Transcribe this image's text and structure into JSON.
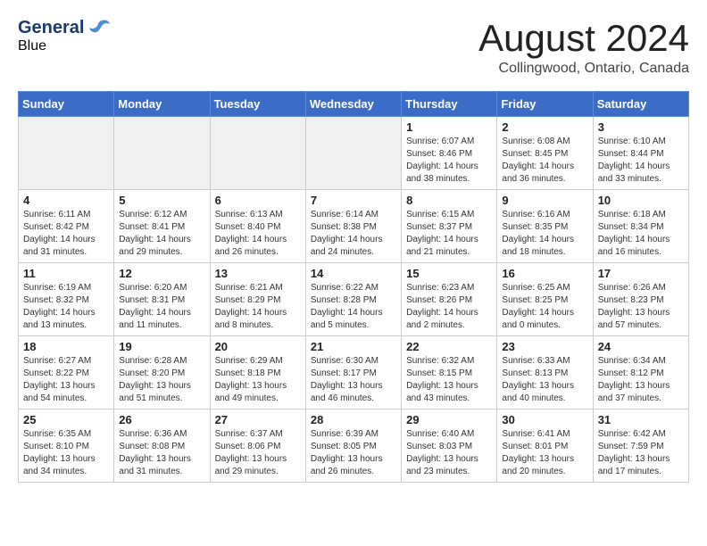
{
  "logo": {
    "general": "General",
    "blue": "Blue"
  },
  "title": "August 2024",
  "location": "Collingwood, Ontario, Canada",
  "days_of_week": [
    "Sunday",
    "Monday",
    "Tuesday",
    "Wednesday",
    "Thursday",
    "Friday",
    "Saturday"
  ],
  "weeks": [
    [
      {
        "day": "",
        "info": ""
      },
      {
        "day": "",
        "info": ""
      },
      {
        "day": "",
        "info": ""
      },
      {
        "day": "",
        "info": ""
      },
      {
        "day": "1",
        "info": "Sunrise: 6:07 AM\nSunset: 8:46 PM\nDaylight: 14 hours and 38 minutes."
      },
      {
        "day": "2",
        "info": "Sunrise: 6:08 AM\nSunset: 8:45 PM\nDaylight: 14 hours and 36 minutes."
      },
      {
        "day": "3",
        "info": "Sunrise: 6:10 AM\nSunset: 8:44 PM\nDaylight: 14 hours and 33 minutes."
      }
    ],
    [
      {
        "day": "4",
        "info": "Sunrise: 6:11 AM\nSunset: 8:42 PM\nDaylight: 14 hours and 31 minutes."
      },
      {
        "day": "5",
        "info": "Sunrise: 6:12 AM\nSunset: 8:41 PM\nDaylight: 14 hours and 29 minutes."
      },
      {
        "day": "6",
        "info": "Sunrise: 6:13 AM\nSunset: 8:40 PM\nDaylight: 14 hours and 26 minutes."
      },
      {
        "day": "7",
        "info": "Sunrise: 6:14 AM\nSunset: 8:38 PM\nDaylight: 14 hours and 24 minutes."
      },
      {
        "day": "8",
        "info": "Sunrise: 6:15 AM\nSunset: 8:37 PM\nDaylight: 14 hours and 21 minutes."
      },
      {
        "day": "9",
        "info": "Sunrise: 6:16 AM\nSunset: 8:35 PM\nDaylight: 14 hours and 18 minutes."
      },
      {
        "day": "10",
        "info": "Sunrise: 6:18 AM\nSunset: 8:34 PM\nDaylight: 14 hours and 16 minutes."
      }
    ],
    [
      {
        "day": "11",
        "info": "Sunrise: 6:19 AM\nSunset: 8:32 PM\nDaylight: 14 hours and 13 minutes."
      },
      {
        "day": "12",
        "info": "Sunrise: 6:20 AM\nSunset: 8:31 PM\nDaylight: 14 hours and 11 minutes."
      },
      {
        "day": "13",
        "info": "Sunrise: 6:21 AM\nSunset: 8:29 PM\nDaylight: 14 hours and 8 minutes."
      },
      {
        "day": "14",
        "info": "Sunrise: 6:22 AM\nSunset: 8:28 PM\nDaylight: 14 hours and 5 minutes."
      },
      {
        "day": "15",
        "info": "Sunrise: 6:23 AM\nSunset: 8:26 PM\nDaylight: 14 hours and 2 minutes."
      },
      {
        "day": "16",
        "info": "Sunrise: 6:25 AM\nSunset: 8:25 PM\nDaylight: 14 hours and 0 minutes."
      },
      {
        "day": "17",
        "info": "Sunrise: 6:26 AM\nSunset: 8:23 PM\nDaylight: 13 hours and 57 minutes."
      }
    ],
    [
      {
        "day": "18",
        "info": "Sunrise: 6:27 AM\nSunset: 8:22 PM\nDaylight: 13 hours and 54 minutes."
      },
      {
        "day": "19",
        "info": "Sunrise: 6:28 AM\nSunset: 8:20 PM\nDaylight: 13 hours and 51 minutes."
      },
      {
        "day": "20",
        "info": "Sunrise: 6:29 AM\nSunset: 8:18 PM\nDaylight: 13 hours and 49 minutes."
      },
      {
        "day": "21",
        "info": "Sunrise: 6:30 AM\nSunset: 8:17 PM\nDaylight: 13 hours and 46 minutes."
      },
      {
        "day": "22",
        "info": "Sunrise: 6:32 AM\nSunset: 8:15 PM\nDaylight: 13 hours and 43 minutes."
      },
      {
        "day": "23",
        "info": "Sunrise: 6:33 AM\nSunset: 8:13 PM\nDaylight: 13 hours and 40 minutes."
      },
      {
        "day": "24",
        "info": "Sunrise: 6:34 AM\nSunset: 8:12 PM\nDaylight: 13 hours and 37 minutes."
      }
    ],
    [
      {
        "day": "25",
        "info": "Sunrise: 6:35 AM\nSunset: 8:10 PM\nDaylight: 13 hours and 34 minutes."
      },
      {
        "day": "26",
        "info": "Sunrise: 6:36 AM\nSunset: 8:08 PM\nDaylight: 13 hours and 31 minutes."
      },
      {
        "day": "27",
        "info": "Sunrise: 6:37 AM\nSunset: 8:06 PM\nDaylight: 13 hours and 29 minutes."
      },
      {
        "day": "28",
        "info": "Sunrise: 6:39 AM\nSunset: 8:05 PM\nDaylight: 13 hours and 26 minutes."
      },
      {
        "day": "29",
        "info": "Sunrise: 6:40 AM\nSunset: 8:03 PM\nDaylight: 13 hours and 23 minutes."
      },
      {
        "day": "30",
        "info": "Sunrise: 6:41 AM\nSunset: 8:01 PM\nDaylight: 13 hours and 20 minutes."
      },
      {
        "day": "31",
        "info": "Sunrise: 6:42 AM\nSunset: 7:59 PM\nDaylight: 13 hours and 17 minutes."
      }
    ]
  ]
}
